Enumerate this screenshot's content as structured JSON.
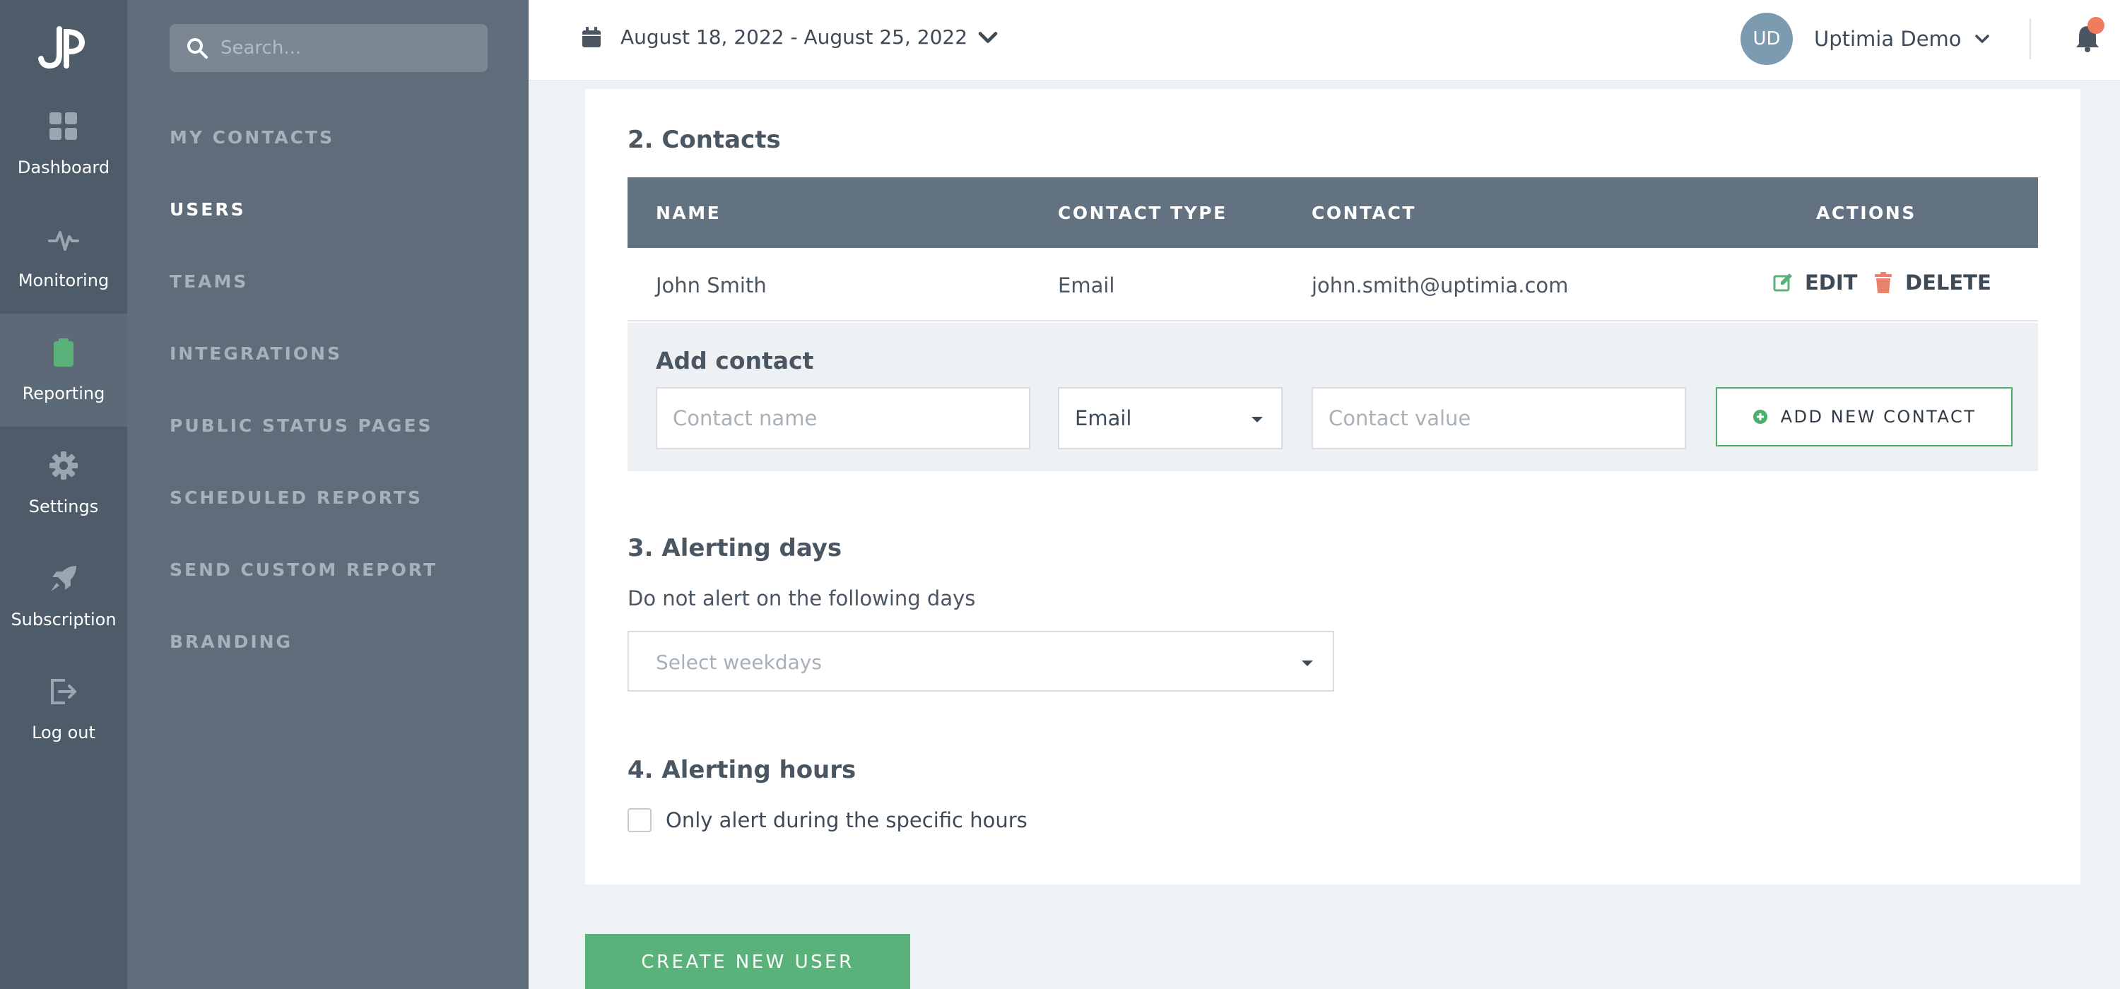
{
  "rail": {
    "items": [
      {
        "label": "Dashboard",
        "icon": "dashboard-icon"
      },
      {
        "label": "Monitoring",
        "icon": "pulse-icon"
      },
      {
        "label": "Reporting",
        "icon": "clipboard-icon"
      },
      {
        "label": "Settings",
        "icon": "gear-icon"
      },
      {
        "label": "Subscription",
        "icon": "rocket-icon"
      },
      {
        "label": "Log out",
        "icon": "logout-icon"
      }
    ],
    "active": "Reporting"
  },
  "search": {
    "placeholder": "Search..."
  },
  "subnav": {
    "items": [
      {
        "label": "MY CONTACTS"
      },
      {
        "label": "USERS"
      },
      {
        "label": "TEAMS"
      },
      {
        "label": "INTEGRATIONS"
      },
      {
        "label": "PUBLIC STATUS PAGES"
      },
      {
        "label": "SCHEDULED REPORTS"
      },
      {
        "label": "SEND CUSTOM REPORT"
      },
      {
        "label": "BRANDING"
      }
    ],
    "active": "USERS"
  },
  "topbar": {
    "date_range": "August 18, 2022 - August 25, 2022",
    "user_initials": "UD",
    "user_name": "Uptimia Demo"
  },
  "contacts": {
    "title": "2. Contacts",
    "columns": [
      "NAME",
      "CONTACT TYPE",
      "CONTACT",
      "ACTIONS"
    ],
    "rows": [
      {
        "name": "John Smith",
        "type": "Email",
        "contact": "john.smith@uptimia.com",
        "edit": "EDIT",
        "delete": "DELETE"
      }
    ],
    "add": {
      "title": "Add contact",
      "name_placeholder": "Contact name",
      "type_value": "Email",
      "value_placeholder": "Contact value",
      "button": "ADD NEW CONTACT"
    }
  },
  "alerting_days": {
    "title": "3. Alerting days",
    "description": "Do not alert on the following days",
    "placeholder": "Select weekdays"
  },
  "alerting_hours": {
    "title": "4. Alerting hours",
    "checkbox_label": "Only alert during the specific hours",
    "checked": false
  },
  "create_button": "CREATE NEW USER",
  "colors": {
    "accent_green": "#5ab27a",
    "rail_bg": "#4e5c69",
    "subnav_bg": "#5f6d7a",
    "table_header": "#627280",
    "delete_red": "#e8826a",
    "notification_dot": "#f07c5e"
  }
}
